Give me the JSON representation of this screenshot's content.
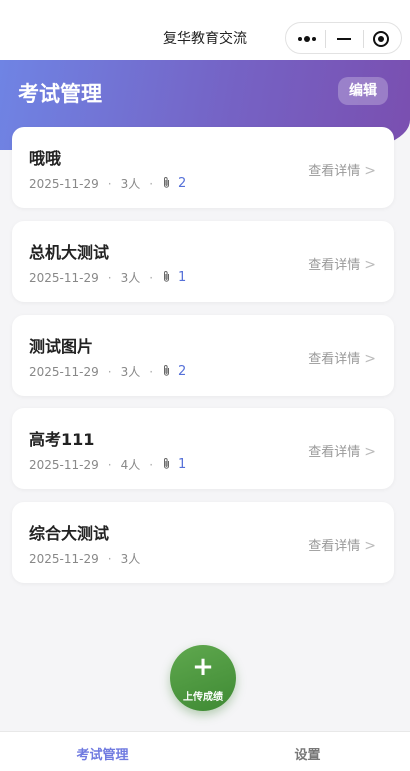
{
  "window": {
    "title": "复华教育交流"
  },
  "header": {
    "title": "考试管理",
    "edit_label": "编辑"
  },
  "exams": [
    {
      "name": "哦哦",
      "date": "2025-11-29",
      "people": "3人",
      "attachments": "2",
      "detail_label": "查看详情",
      "arrow": ">"
    },
    {
      "name": "总机大测试",
      "date": "2025-11-29",
      "people": "3人",
      "attachments": "1",
      "detail_label": "查看详情",
      "arrow": ">"
    },
    {
      "name": "测试图片",
      "date": "2025-11-29",
      "people": "3人",
      "attachments": "2",
      "detail_label": "查看详情",
      "arrow": ">"
    },
    {
      "name": "高考111",
      "date": "2025-11-29",
      "people": "4人",
      "attachments": "1",
      "detail_label": "查看详情",
      "arrow": ">"
    },
    {
      "name": "综合大测试",
      "date": "2025-11-29",
      "people": "3人",
      "attachments": null,
      "detail_label": "查看详情",
      "arrow": ">"
    }
  ],
  "fab": {
    "icon": "+",
    "label": "上传成绩"
  },
  "tabs": [
    {
      "label": "考试管理",
      "active": true
    },
    {
      "label": "设置",
      "active": false
    }
  ],
  "colors": {
    "accent": "#6f7ae0",
    "fab": "#4d9a40",
    "header_start": "#6f84e4",
    "header_end": "#7a4fb0"
  },
  "icons": {
    "more": "more-dots-icon",
    "minimize": "minimize-icon",
    "close": "target-icon",
    "attachment": "paperclip-icon"
  }
}
